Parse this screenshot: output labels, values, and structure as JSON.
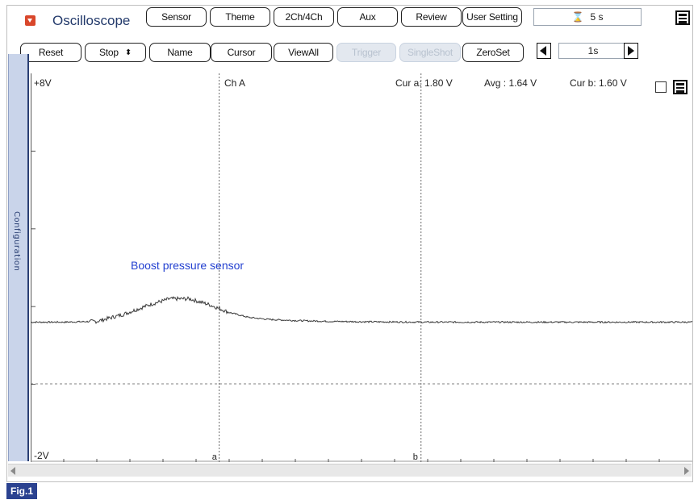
{
  "app": {
    "title": "Oscilloscope"
  },
  "toolbar_top": {
    "sensor": "Sensor",
    "theme": "Theme",
    "channels": "2Ch/4Ch",
    "aux": "Aux",
    "review": "Review",
    "user_setting": "User Setting",
    "timebase": "5 s"
  },
  "toolbar_bottom": {
    "reset": "Reset",
    "stop": "Stop",
    "name": "Name",
    "cursor": "Cursor",
    "view_all": "ViewAll",
    "trigger": "Trigger",
    "single_shot": "SingleShot",
    "zero_set": "ZeroSet",
    "step_value": "1s"
  },
  "sidebar": {
    "label": "Configuration"
  },
  "plot": {
    "y_max_label": "+8V",
    "y_min_label": "-2V",
    "channel_label": "Ch A",
    "cur_a": "Cur a: 1.80 V",
    "avg": "Avg  : 1.64 V",
    "cur_b": "Cur b: 1.60 V",
    "signal_label": "Boost pressure sensor",
    "cursor_a_marker": "a",
    "cursor_b_marker": "b"
  },
  "figure": {
    "label": "Fig.1"
  },
  "colors": {
    "trace": "#3a3a3a",
    "signal_label": "#2340d0",
    "title": "#233a6b",
    "sidebar": "#c9d4ea",
    "fig_badge": "#2b4290"
  },
  "chart_data": {
    "type": "line",
    "ylim": [
      -2,
      8
    ],
    "y_divisions": 5,
    "x_divisions": 10,
    "series": [
      {
        "x": [
          0,
          0.5,
          1.0,
          1.4,
          1.8,
          2.1,
          2.4,
          2.7,
          3.0,
          3.3,
          3.6,
          4.0,
          4.5,
          5.0,
          6.0,
          7.0,
          8.0,
          9.0,
          10.0
        ],
        "values": [
          1.6,
          1.6,
          1.62,
          1.8,
          2.05,
          2.2,
          2.2,
          2.05,
          1.85,
          1.72,
          1.67,
          1.64,
          1.62,
          1.61,
          1.6,
          1.6,
          1.6,
          1.6,
          1.6
        ]
      }
    ],
    "cursor_a_x": 2.85,
    "cursor_b_x": 5.9
  }
}
